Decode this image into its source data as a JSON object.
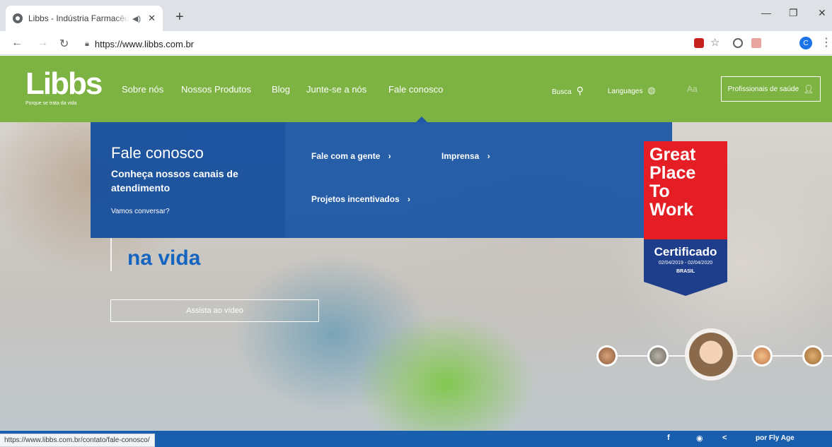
{
  "browser": {
    "tab_title": "Libbs - Indústria Farmacêutica",
    "url": "https://www.libbs.com.br",
    "profile_initial": "C",
    "status_url": "https://www.libbs.com.br/contato/fale-conosco/"
  },
  "site": {
    "logo": "Libbs",
    "tagline": "Porque se trata da vida",
    "nav": [
      "Sobre nós",
      "Nossos Produtos",
      "Blog",
      "Junte-se a nós",
      "Fale conosco"
    ],
    "search_label": "Busca",
    "languages_label": "Languages",
    "font_size_label": "Aa",
    "professionals_button": "Profissionais de saúde"
  },
  "dropdown": {
    "title": "Fale conosco",
    "subtitle": "Conheça nossos canais de atendimento",
    "cta": "Vamos conversar?",
    "links": [
      "Fale com a gente",
      "Imprensa",
      "Projetos incentivados"
    ]
  },
  "hero": {
    "title_line": "na vida",
    "video_button": "Assista ao vídeo"
  },
  "badge": {
    "lines": [
      "Great",
      "Place",
      "To",
      "Work"
    ],
    "certified": "Certificado",
    "dates": "02/04/2019 - 02/04/2020",
    "country": "BRASIL"
  },
  "footer": {
    "credit": "por Fly Age"
  },
  "colors": {
    "nav_green": "#7cb342",
    "dropdown_blue": "#1955a5",
    "footer_blue": "#1a5fad",
    "badge_red": "#e51e25"
  },
  "icons": [
    "search-icon",
    "globe-icon",
    "user-icon",
    "facebook-icon",
    "instagram-icon",
    "share-icon"
  ]
}
